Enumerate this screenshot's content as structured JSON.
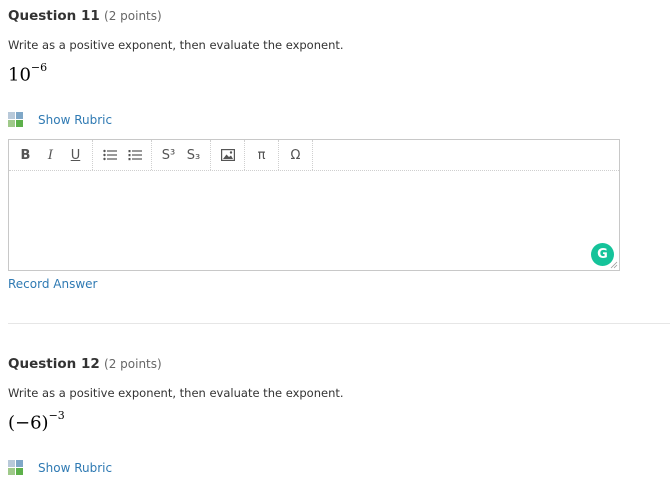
{
  "question11": {
    "title": "Question 11",
    "points": "(2 points)",
    "prompt": "Write as a positive exponent, then evaluate the exponent.",
    "math_base": "10",
    "math_exponent": "−6",
    "rubric_label": "Show Rubric",
    "record_label": "Record Answer"
  },
  "editor": {
    "toolbar": [
      "B",
      "I",
      "U",
      "bulleted-list-icon",
      "numbered-list-icon",
      "S³",
      "S₃",
      "image-icon",
      "π",
      "Ω"
    ],
    "bold": "B",
    "italic": "I",
    "underline": "U",
    "superscript": "S³",
    "subscript": "S₃",
    "pi": "π",
    "omega": "Ω",
    "grammarly": "G",
    "content": ""
  },
  "question12": {
    "title": "Question 12",
    "points": "(2 points)",
    "prompt": "Write as a positive exponent, then evaluate the exponent.",
    "math_base": "(−6)",
    "math_exponent": "−3",
    "rubric_label": "Show Rubric"
  },
  "colors": {
    "link": "#2f7ab3",
    "grammarly": "#15c39a",
    "rubric_icon": [
      "#b8c9d9",
      "#7fa7c7",
      "#9fc98a",
      "#5db04a"
    ]
  }
}
